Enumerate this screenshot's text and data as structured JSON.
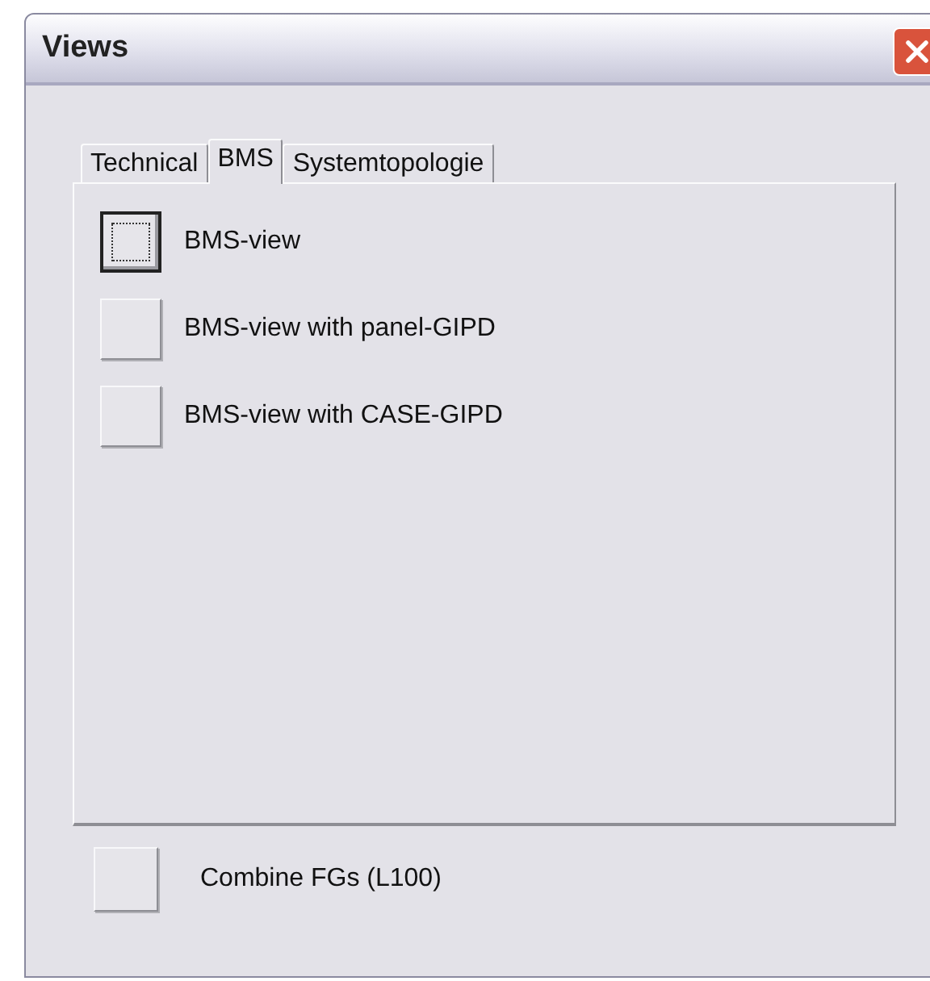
{
  "window": {
    "title": "Views"
  },
  "tabs": [
    {
      "label": "Technical",
      "selected": false
    },
    {
      "label": "BMS",
      "selected": true
    },
    {
      "label": "Systemtopologie",
      "selected": false
    }
  ],
  "view_buttons": [
    {
      "label": "BMS-view",
      "focused": true
    },
    {
      "label": "BMS-view with panel-GIPD",
      "focused": false
    },
    {
      "label": "BMS-view with CASE-GIPD",
      "focused": false
    }
  ],
  "combine_button": {
    "label": "Combine FGs (L100)",
    "focused": false
  }
}
